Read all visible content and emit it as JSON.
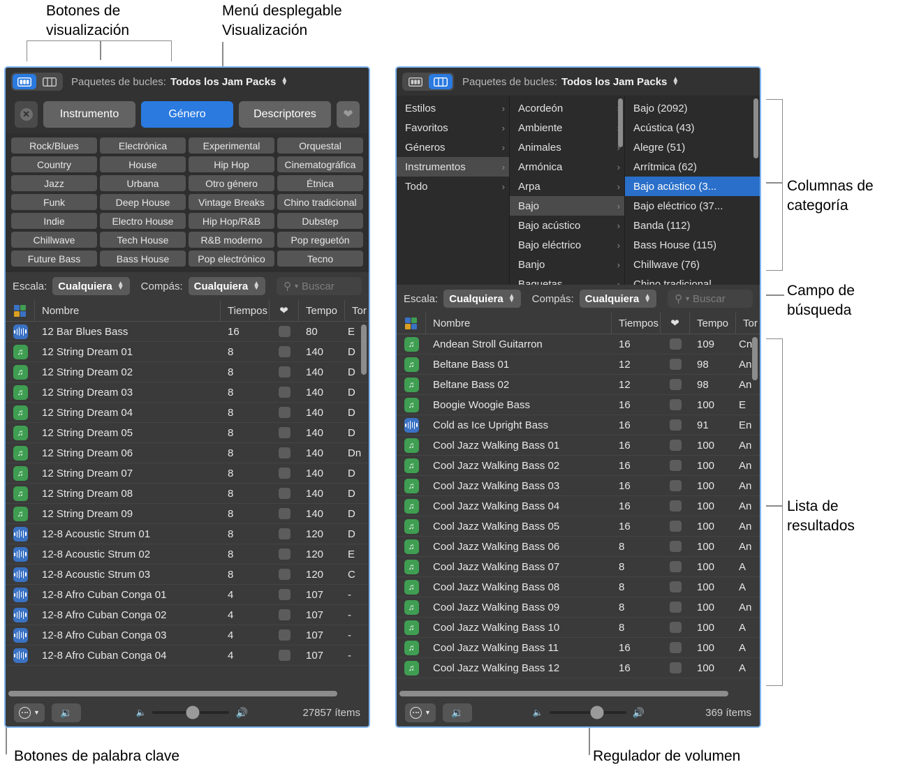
{
  "annotations": [
    {
      "id": "view-buttons",
      "text": "Botones de\nvisualización"
    },
    {
      "id": "view-menu",
      "text": "Menú desplegable\nVisualización"
    },
    {
      "id": "category-columns",
      "text": "Columnas de\ncategoría"
    },
    {
      "id": "search-field",
      "text": "Campo de\nbúsqueda"
    },
    {
      "id": "results-list",
      "text": "Lista de\nresultados"
    },
    {
      "id": "keyword-buttons",
      "text": "Botones de palabra clave"
    },
    {
      "id": "volume-slider",
      "text": "Regulador de volumen"
    }
  ],
  "colors": {
    "accent_blue": "#2a7ae0",
    "selection_blue": "#2a6fc9",
    "window_border": "#7eb4f0",
    "panel_bg": "#2e2e2e",
    "toolbar_bg": "#323232",
    "table_bg": "#3a3a3a",
    "keyword_btn": "#555555",
    "icon_green": "#3f9e52",
    "icon_blue": "#3a72c4"
  },
  "left_window": {
    "topbar": {
      "button_view_icon": "grid-view-icon",
      "column_view_icon": "column-view-icon",
      "active_view": "button",
      "label": "Paquetes de bucles:",
      "value": "Todos los Jam Packs",
      "stepper_icon": "up-down-chevron-icon"
    },
    "keyword_tabs": {
      "clear_icon": "clear-circle-icon",
      "tabs": [
        "Instrumento",
        "Género",
        "Descriptores"
      ],
      "selected": "Género",
      "favorite_icon": "heart-icon"
    },
    "keyword_grid": [
      "Rock/Blues",
      "Electrónica",
      "Experimental",
      "Orquestal",
      "Country",
      "House",
      "Hip Hop",
      "Cinematográfica",
      "Jazz",
      "Urbana",
      "Otro género",
      "Étnica",
      "Funk",
      "Deep House",
      "Vintage Breaks",
      "Chino tradicional",
      "Indie",
      "Electro House",
      "Hip Hop/R&B",
      "Dubstep",
      "Chillwave",
      "Tech House",
      "R&B moderno",
      "Pop reguetón",
      "Future Bass",
      "Bass House",
      "Pop electrónico",
      "Tecno"
    ],
    "filterbar": {
      "scale_label": "Escala:",
      "scale_value": "Cualquiera",
      "meter_label": "Compás:",
      "meter_value": "Cualquiera",
      "search_icon": "magnifier-icon",
      "search_placeholder": "Buscar",
      "search_value": ""
    },
    "table": {
      "headers": {
        "icon": "loop-kind-icon",
        "name": "Nombre",
        "beats": "Tiempos",
        "fav": "heart-icon",
        "tempo": "Tempo",
        "key": "Tor"
      },
      "rows": [
        {
          "icon": "blue",
          "name": "12 Bar Blues Bass",
          "beats": "16",
          "tempo": "80",
          "key": "E"
        },
        {
          "icon": "green",
          "name": "12 String Dream 01",
          "beats": "8",
          "tempo": "140",
          "key": "D"
        },
        {
          "icon": "green",
          "name": "12 String Dream 02",
          "beats": "8",
          "tempo": "140",
          "key": "D"
        },
        {
          "icon": "green",
          "name": "12 String Dream 03",
          "beats": "8",
          "tempo": "140",
          "key": "D"
        },
        {
          "icon": "green",
          "name": "12 String Dream 04",
          "beats": "8",
          "tempo": "140",
          "key": "D"
        },
        {
          "icon": "green",
          "name": "12 String Dream 05",
          "beats": "8",
          "tempo": "140",
          "key": "D"
        },
        {
          "icon": "green",
          "name": "12 String Dream 06",
          "beats": "8",
          "tempo": "140",
          "key": "Dn"
        },
        {
          "icon": "green",
          "name": "12 String Dream 07",
          "beats": "8",
          "tempo": "140",
          "key": "D"
        },
        {
          "icon": "green",
          "name": "12 String Dream 08",
          "beats": "8",
          "tempo": "140",
          "key": "D"
        },
        {
          "icon": "green",
          "name": "12 String Dream 09",
          "beats": "8",
          "tempo": "140",
          "key": "D"
        },
        {
          "icon": "blue",
          "name": "12-8 Acoustic Strum 01",
          "beats": "8",
          "tempo": "120",
          "key": "D"
        },
        {
          "icon": "blue",
          "name": "12-8 Acoustic Strum 02",
          "beats": "8",
          "tempo": "120",
          "key": "E"
        },
        {
          "icon": "blue",
          "name": "12-8 Acoustic Strum 03",
          "beats": "8",
          "tempo": "120",
          "key": "C"
        },
        {
          "icon": "blue",
          "name": "12-8 Afro Cuban Conga 01",
          "beats": "4",
          "tempo": "107",
          "key": "-"
        },
        {
          "icon": "blue",
          "name": "12-8 Afro Cuban Conga 02",
          "beats": "4",
          "tempo": "107",
          "key": "-"
        },
        {
          "icon": "blue",
          "name": "12-8 Afro Cuban Conga 03",
          "beats": "4",
          "tempo": "107",
          "key": "-"
        },
        {
          "icon": "blue",
          "name": "12-8 Afro Cuban Conga 04",
          "beats": "4",
          "tempo": "107",
          "key": "-"
        }
      ]
    },
    "bottombar": {
      "options_icon": "circle-ellipsis-icon",
      "options_chevron": "chevron-down-icon",
      "mute_icon": "speaker-mute-icon",
      "vol_low_icon": "speaker-low-icon",
      "vol_high_icon": "speaker-high-icon",
      "volume_percent": 52,
      "item_count": "27857 ítems"
    }
  },
  "right_window": {
    "topbar": {
      "button_view_icon": "grid-view-icon",
      "column_view_icon": "column-view-icon",
      "active_view": "column",
      "label": "Paquetes de bucles:",
      "value": "Todos los Jam Packs",
      "stepper_icon": "up-down-chevron-icon"
    },
    "columns": [
      {
        "name": "column-1",
        "items": [
          {
            "label": "Estilos",
            "state": "normal"
          },
          {
            "label": "Favoritos",
            "state": "normal"
          },
          {
            "label": "Géneros",
            "state": "normal"
          },
          {
            "label": "Instrumentos",
            "state": "selected-gray"
          },
          {
            "label": "Todo",
            "state": "normal"
          }
        ]
      },
      {
        "name": "column-2",
        "items": [
          {
            "label": "Acordeón",
            "state": "normal"
          },
          {
            "label": "Ambiente",
            "state": "normal"
          },
          {
            "label": "Animales",
            "state": "normal"
          },
          {
            "label": "Armónica",
            "state": "normal"
          },
          {
            "label": "Arpa",
            "state": "normal"
          },
          {
            "label": "Bajo",
            "state": "selected-gray"
          },
          {
            "label": "Bajo acústico",
            "state": "normal"
          },
          {
            "label": "Bajo eléctrico",
            "state": "normal"
          },
          {
            "label": "Banjo",
            "state": "normal"
          },
          {
            "label": "Baquetas",
            "state": "normal"
          }
        ]
      },
      {
        "name": "column-3",
        "items": [
          {
            "label": "Bajo (2092)",
            "state": "normal"
          },
          {
            "label": "Acústica (43)",
            "state": "normal"
          },
          {
            "label": "Alegre (51)",
            "state": "normal"
          },
          {
            "label": "Arrítmica (62)",
            "state": "normal"
          },
          {
            "label": "Bajo acústico (3...",
            "state": "selected-blue"
          },
          {
            "label": "Bajo eléctrico (37...",
            "state": "normal"
          },
          {
            "label": "Banda (112)",
            "state": "normal"
          },
          {
            "label": "Bass House (115)",
            "state": "normal"
          },
          {
            "label": "Chillwave (76)",
            "state": "normal"
          },
          {
            "label": "Chino tradicional",
            "state": "normal"
          }
        ]
      }
    ],
    "filterbar": {
      "scale_label": "Escala:",
      "scale_value": "Cualquiera",
      "meter_label": "Compás:",
      "meter_value": "Cualquiera",
      "search_icon": "magnifier-icon",
      "search_placeholder": "Buscar",
      "search_value": ""
    },
    "table": {
      "headers": {
        "icon": "loop-kind-icon",
        "name": "Nombre",
        "beats": "Tiempos",
        "fav": "heart-icon",
        "tempo": "Tempo",
        "key": "Tor"
      },
      "rows": [
        {
          "icon": "green",
          "name": "Andean Stroll Guitarron",
          "beats": "16",
          "tempo": "109",
          "key": "Cn"
        },
        {
          "icon": "green",
          "name": "Beltane Bass 01",
          "beats": "12",
          "tempo": "98",
          "key": "An"
        },
        {
          "icon": "green",
          "name": "Beltane Bass 02",
          "beats": "12",
          "tempo": "98",
          "key": "An"
        },
        {
          "icon": "green",
          "name": "Boogie Woogie Bass",
          "beats": "16",
          "tempo": "100",
          "key": "E"
        },
        {
          "icon": "blue",
          "name": "Cold as Ice Upright Bass",
          "beats": "16",
          "tempo": "91",
          "key": "En"
        },
        {
          "icon": "green",
          "name": "Cool Jazz Walking Bass 01",
          "beats": "16",
          "tempo": "100",
          "key": "An"
        },
        {
          "icon": "green",
          "name": "Cool Jazz Walking Bass 02",
          "beats": "16",
          "tempo": "100",
          "key": "An"
        },
        {
          "icon": "green",
          "name": "Cool Jazz Walking Bass 03",
          "beats": "16",
          "tempo": "100",
          "key": "An"
        },
        {
          "icon": "green",
          "name": "Cool Jazz Walking Bass 04",
          "beats": "16",
          "tempo": "100",
          "key": "An"
        },
        {
          "icon": "green",
          "name": "Cool Jazz Walking Bass 05",
          "beats": "16",
          "tempo": "100",
          "key": "An"
        },
        {
          "icon": "green",
          "name": "Cool Jazz Walking Bass 06",
          "beats": "8",
          "tempo": "100",
          "key": "An"
        },
        {
          "icon": "green",
          "name": "Cool Jazz Walking Bass 07",
          "beats": "8",
          "tempo": "100",
          "key": "A"
        },
        {
          "icon": "green",
          "name": "Cool Jazz Walking Bass 08",
          "beats": "8",
          "tempo": "100",
          "key": "A"
        },
        {
          "icon": "green",
          "name": "Cool Jazz Walking Bass 09",
          "beats": "8",
          "tempo": "100",
          "key": "An"
        },
        {
          "icon": "green",
          "name": "Cool Jazz Walking Bass 10",
          "beats": "8",
          "tempo": "100",
          "key": "A"
        },
        {
          "icon": "green",
          "name": "Cool Jazz Walking Bass 11",
          "beats": "16",
          "tempo": "100",
          "key": "A"
        },
        {
          "icon": "green",
          "name": "Cool Jazz Walking Bass 12",
          "beats": "16",
          "tempo": "100",
          "key": "A"
        }
      ]
    },
    "bottombar": {
      "options_icon": "circle-ellipsis-icon",
      "options_chevron": "chevron-down-icon",
      "mute_icon": "speaker-mute-icon",
      "vol_low_icon": "speaker-low-icon",
      "vol_high_icon": "speaker-high-icon",
      "volume_percent": 62,
      "item_count": "369 ítems"
    }
  }
}
